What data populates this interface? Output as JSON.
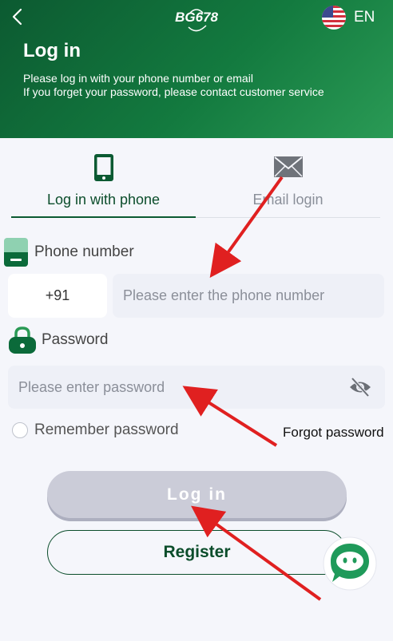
{
  "header": {
    "logo_text": "BG678",
    "language": "EN",
    "title": "Log in",
    "subtitle_line1": "Please log in with your phone number or email",
    "subtitle_line2": "If you forget your password, please contact customer service"
  },
  "tabs": [
    {
      "label": "Log in with phone",
      "icon": "phone-icon",
      "active": true
    },
    {
      "label": "Email login",
      "icon": "mail-icon",
      "active": false
    }
  ],
  "phone_field": {
    "label": "Phone number",
    "country_code": "+91",
    "placeholder": "Please enter the phone number"
  },
  "password_field": {
    "label": "Password",
    "placeholder": "Please enter password"
  },
  "remember_label": "Remember password",
  "forgot_label": "Forgot password",
  "buttons": {
    "login": "Log in",
    "register": "Register"
  },
  "colors": {
    "brand_green": "#0b5a32",
    "annotation_red": "#e02020",
    "login_disabled": "#cbccd8"
  }
}
